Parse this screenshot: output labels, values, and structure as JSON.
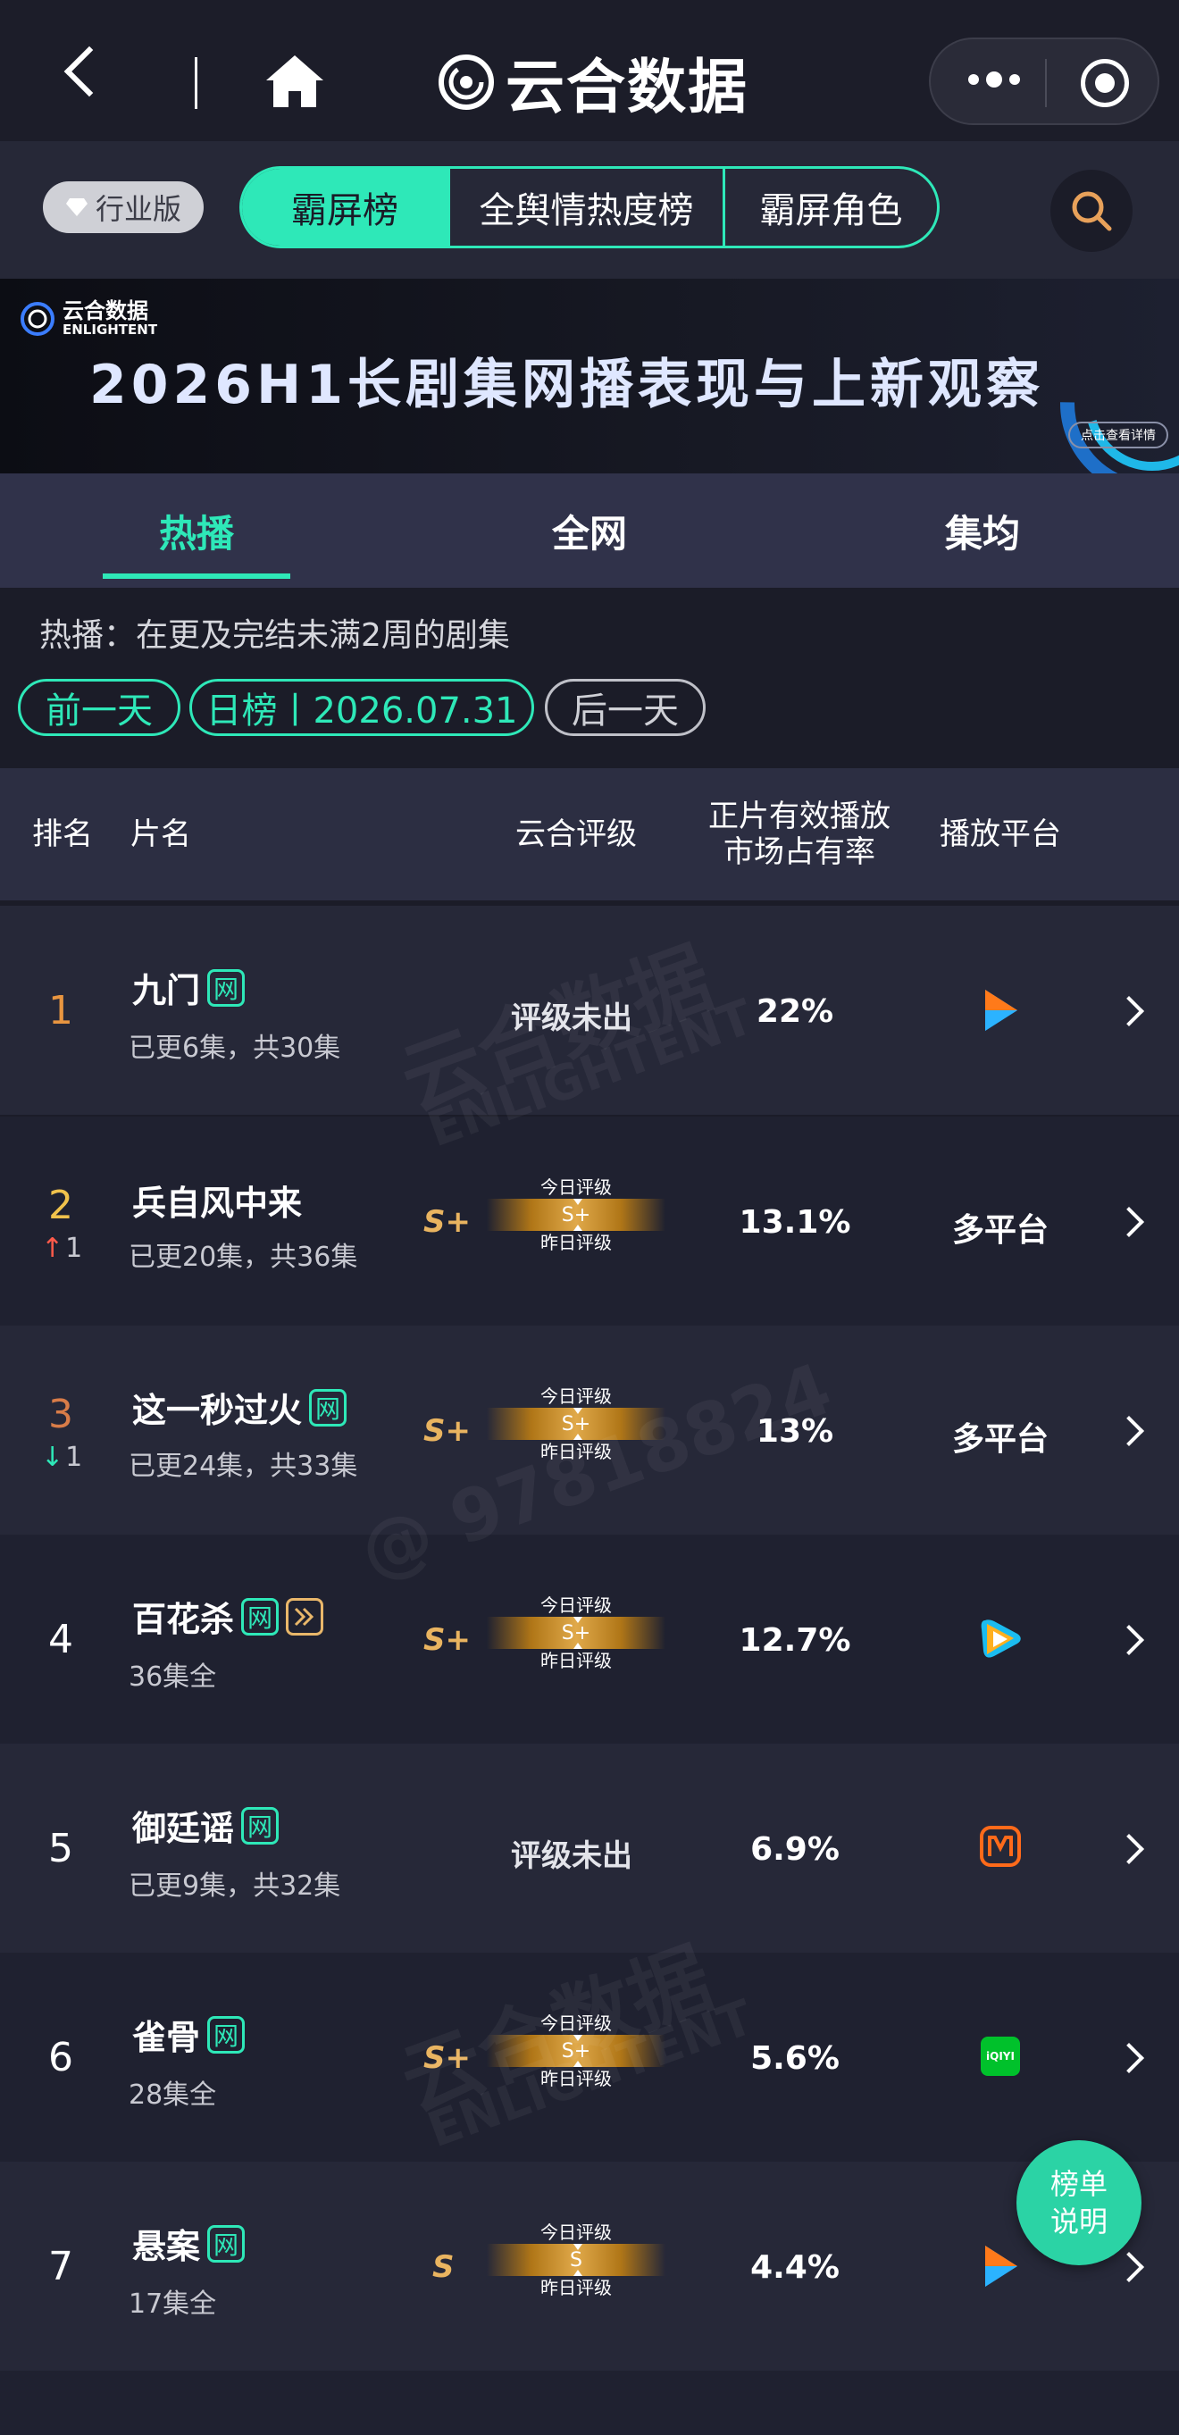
{
  "header": {
    "brand_name": "云合数据"
  },
  "subbar": {
    "industry_badge": "行业版",
    "tabs": [
      {
        "label": "霸屏榜",
        "active": true
      },
      {
        "label": "全舆情热度榜",
        "active": false
      },
      {
        "label": "霸屏角色",
        "active": false
      }
    ]
  },
  "banner": {
    "logo_cn": "云合数据",
    "logo_en": "ENLIGHTENT",
    "title": "2026H1长剧集网播表现与上新观察",
    "button": "点击查看详情"
  },
  "view_tabs": [
    {
      "label": "热播",
      "active": true
    },
    {
      "label": "全网",
      "active": false
    },
    {
      "label": "集均",
      "active": false
    }
  ],
  "description": "热播：在更及完结未满2周的剧集",
  "date_nav": {
    "prev": "前一天",
    "current": "日榜丨2026.07.31",
    "next": "后一天"
  },
  "table": {
    "headers": {
      "rank": "排名",
      "title": "片名",
      "rating": "云合评级",
      "share_line1": "正片有效播放",
      "share_line2": "市场占有率",
      "platform": "播放平台"
    },
    "rating_today_label": "今日评级",
    "rating_yesterday_label": "昨日评级",
    "net_tag": "网",
    "rows": [
      {
        "rank": "1",
        "title": "九门",
        "episodes": "已更6集，共30集",
        "rating": "评级未出",
        "share": "22%",
        "platform_icon": "youku-icon"
      },
      {
        "rank": "2",
        "change_dir": "up",
        "change": "1",
        "title": "兵自风中来",
        "episodes": "已更20集，共36集",
        "grade": "S+",
        "gauge_grade": "S+",
        "share": "13.1%",
        "platform_text": "多平台"
      },
      {
        "rank": "3",
        "change_dir": "down",
        "change": "1",
        "title": "这一秒过火",
        "episodes": "已更24集，共33集",
        "grade": "S+",
        "gauge_grade": "S+",
        "share": "13%",
        "platform_text": "多平台"
      },
      {
        "rank": "4",
        "title": "百花杀",
        "episodes": "36集全",
        "grade": "S+",
        "gauge_grade": "S+",
        "share": "12.7%",
        "platform_icon": "tencent-video-icon"
      },
      {
        "rank": "5",
        "title": "御廷谣",
        "episodes": "已更9集，共32集",
        "rating": "评级未出",
        "share": "6.9%",
        "platform_icon": "mango-tv-icon"
      },
      {
        "rank": "6",
        "title": "雀骨",
        "episodes": "28集全",
        "grade": "S+",
        "gauge_grade": "S+",
        "share": "5.6%",
        "platform_icon": "iqiyi-icon",
        "platform_icon_text": "iQIYI"
      },
      {
        "rank": "7",
        "title": "悬案",
        "episodes": "17集全",
        "grade": "S",
        "gauge_grade": "S",
        "share": "4.4%",
        "platform_icon": "youku-icon"
      }
    ]
  },
  "watermarks": {
    "logo_cn": "云合数据",
    "logo_en": "ENLIGHTENT",
    "id_mark": "@ 97818824"
  },
  "fab": {
    "line1": "榜单",
    "line2": "说明"
  },
  "colors": {
    "accent": "#2ee8b8",
    "rank_top": "#e89540",
    "rank_2": "#f0c24c",
    "rank_3": "#d87c48",
    "up": "#ff5a4a",
    "down": "#2ee8b8",
    "grade": "#e9b460"
  }
}
